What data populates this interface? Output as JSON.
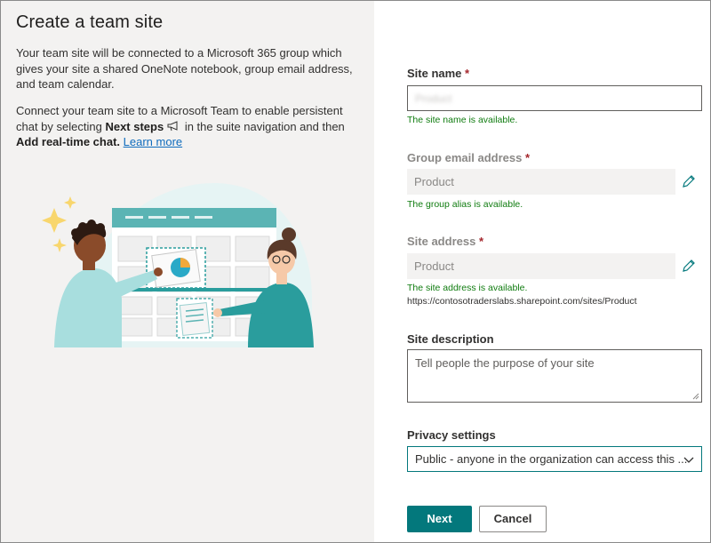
{
  "panel": {
    "title": "Create a team site",
    "para1": "Your team site will be connected to a Microsoft 365 group which gives your site a shared OneNote notebook, group email address, and team calendar.",
    "para2_a": "Connect your team site to a Microsoft Team to enable persistent chat by selecting ",
    "para2_b": "Next steps",
    "para2_c": " in the suite navigation and then ",
    "para2_d": "Add real-time chat.",
    "para2_link": "Learn more"
  },
  "form": {
    "site_name": {
      "label": "Site name",
      "required": "*",
      "value": "Product",
      "status": "The site name is available."
    },
    "group_email": {
      "label": "Group email address",
      "required": "*",
      "value": "Product",
      "status": "The group alias is available."
    },
    "site_address": {
      "label": "Site address",
      "required": "*",
      "value": "Product",
      "status": "The site address is available.",
      "url": "https://contosotraderslabs.sharepoint.com/sites/Product"
    },
    "description": {
      "label": "Site description",
      "placeholder": "Tell people the purpose of your site"
    },
    "privacy": {
      "label": "Privacy settings",
      "value": "Public - anyone in the organization can access this ..."
    }
  },
  "buttons": {
    "next": "Next",
    "cancel": "Cancel"
  },
  "icons": {
    "edit": "pencil-icon",
    "dropdown": "chevron-down-icon",
    "next_steps": "megaphone-icon"
  },
  "colors": {
    "accent": "#03787c",
    "success": "#107c10",
    "required": "#a4262c",
    "link": "#0f6cbd"
  }
}
